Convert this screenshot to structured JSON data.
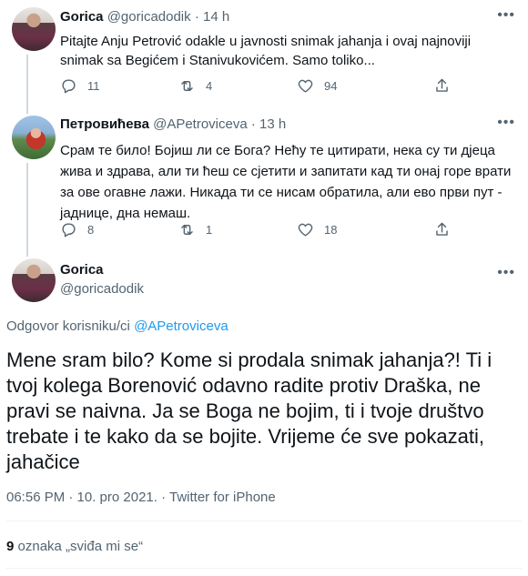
{
  "tweets": [
    {
      "name": "Gorica",
      "handle": "@goricadodik",
      "separator": "·",
      "time": "14 h",
      "text": "Pitajte Anju Petrović odakle u javnosti snimak jahanja i ovaj najnoviji snimak sa Begićem i Stanivukovićem. Samo toliko...",
      "replies": "11",
      "retweets": "4",
      "likes": "94"
    },
    {
      "name": "Петровићева",
      "handle": "@APetroviceva",
      "separator": "·",
      "time": "13 h",
      "text": "Срам те било! Бојиш ли се Бога? Нећу те цитирати, нека су ти дјеца жива и здрава, али ти ћеш се сјетити и запитати кад ти онај горе врати за ове огавне лажи. Никада ти се нисам обратила, али ево први пут - јаднице, дна немаш.",
      "replies": "8",
      "retweets": "1",
      "likes": "18"
    }
  ],
  "main": {
    "name": "Gorica",
    "handle": "@goricadodik",
    "reply_prefix": "Odgovor korisniku/ci ",
    "reply_mention": "@APetroviceva",
    "text": "Mene sram bilo? Kome si prodala snimak jahanja?! Ti i tvoj kolega Borenović odavno radite protiv Draška, ne pravi se naivna. Ja se Boga ne bojim, ti i tvoje društvo trebate i te kako da se bojite. Vrijeme će sve pokazati, jahačice",
    "timestamp": "06:56 PM · 10. pro 2021. · ",
    "source": "Twitter for iPhone",
    "like_count": "9",
    "like_label": " oznaka „sviđa mi se“"
  },
  "icons": {
    "reply": "reply-icon",
    "retweet": "retweet-icon",
    "like": "heart-icon",
    "share": "share-icon",
    "more": "more-icon"
  },
  "colors": {
    "text": "#0f1419",
    "secondary": "#536471",
    "link": "#1d9bf0",
    "thread_line": "#cfd9de"
  }
}
